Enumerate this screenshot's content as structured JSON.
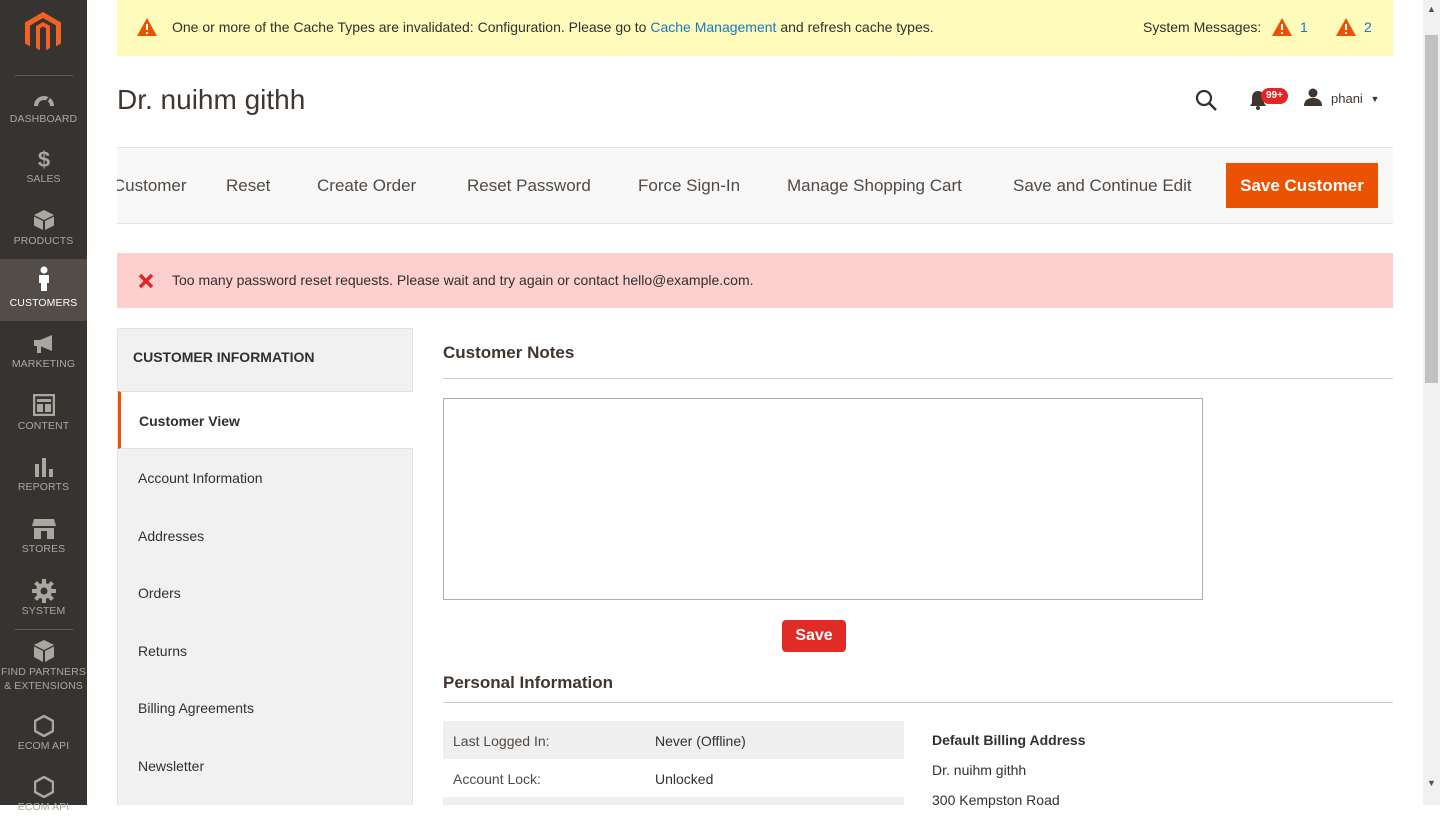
{
  "sidebar": {
    "items": [
      {
        "label": "DASHBOARD",
        "icon": "dashboard-icon"
      },
      {
        "label": "SALES",
        "icon": "dollar-icon"
      },
      {
        "label": "PRODUCTS",
        "icon": "box-icon"
      },
      {
        "label": "CUSTOMERS",
        "icon": "person-icon"
      },
      {
        "label": "MARKETING",
        "icon": "megaphone-icon"
      },
      {
        "label": "CONTENT",
        "icon": "layout-icon"
      },
      {
        "label": "REPORTS",
        "icon": "bar-chart-icon"
      },
      {
        "label": "STORES",
        "icon": "store-icon"
      },
      {
        "label": "SYSTEM",
        "icon": "gear-icon"
      },
      {
        "label_line1": "FIND PARTNERS",
        "label_line2": "& EXTENSIONS",
        "icon": "extensions-icon"
      },
      {
        "label": "ECOM API",
        "icon": "hexagon-icon"
      },
      {
        "label": "ECOM API",
        "icon": "hexagon-icon"
      }
    ],
    "active": "CUSTOMERS"
  },
  "system_message": {
    "text_before": "One or more of the Cache Types are invalidated: Configuration. Please go to ",
    "link": "Cache Management",
    "text_after": " and refresh cache types.",
    "label": "System Messages:",
    "critical_count": "1",
    "major_count": "2"
  },
  "header": {
    "title": "Dr. nuihm githh",
    "notification_badge": "99+",
    "user": "phani"
  },
  "toolbar": {
    "delete_label": "Delete Customer",
    "reset_label": "Reset",
    "create_order_label": "Create Order",
    "reset_password_label": "Reset Password",
    "force_signin_label": "Force Sign-In",
    "manage_cart_label": "Manage Shopping Cart",
    "save_continue_label": "Save and Continue Edit",
    "save_customer_label": "Save Customer"
  },
  "error_message": "Too many password reset requests. Please wait and try again or contact hello@example.com.",
  "tabs": {
    "title": "CUSTOMER INFORMATION",
    "items": [
      "Customer View",
      "Account Information",
      "Addresses",
      "Orders",
      "Returns",
      "Billing Agreements",
      "Newsletter"
    ],
    "active": "Customer View"
  },
  "main": {
    "notes_title": "Customer Notes",
    "notes_value": "",
    "save_label": "Save",
    "personal_title": "Personal Information",
    "personal_rows": [
      {
        "label": "Last Logged In:",
        "value": "Never (Offline)"
      },
      {
        "label": "Account Lock:",
        "value": "Unlocked"
      }
    ],
    "billing_title": "Default Billing Address",
    "billing_lines": [
      "Dr. nuihm githh",
      "300 Kempston Road"
    ]
  },
  "colors": {
    "sidebar_bg": "#373330",
    "accent": "#eb5202",
    "warning_bg": "#fffbbb",
    "error_bg": "#fdcfcf",
    "link": "#1979c3"
  }
}
